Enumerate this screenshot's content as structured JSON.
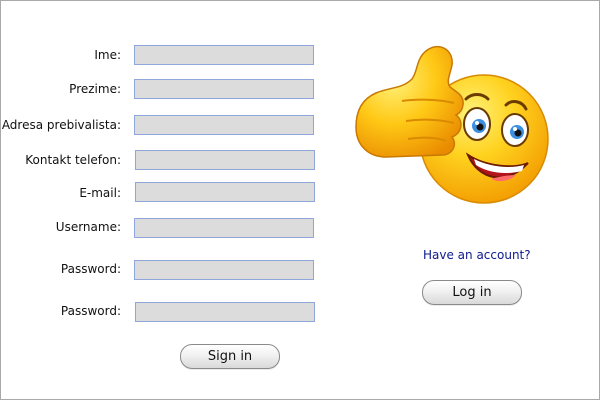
{
  "form": {
    "fields": [
      {
        "label": "Ime:",
        "value": "",
        "placeholder": ""
      },
      {
        "label": "Prezime:",
        "value": "",
        "placeholder": ""
      },
      {
        "label": "Adresa prebivalista:",
        "value": "",
        "placeholder": ""
      },
      {
        "label": "Kontakt telefon:",
        "value": "",
        "placeholder": ""
      },
      {
        "label": "E-mail:",
        "value": "",
        "placeholder": ""
      },
      {
        "label": "Username:",
        "value": "",
        "placeholder": ""
      },
      {
        "label": "Password:",
        "value": "",
        "placeholder": ""
      },
      {
        "label": "Password:",
        "value": "",
        "placeholder": ""
      }
    ],
    "sign_in_label": "Sign in"
  },
  "login": {
    "prompt": "Have an account?",
    "button_label": "Log in"
  },
  "image": {
    "icon": "thumbs-up-smiley-icon"
  },
  "colors": {
    "field_background": "#dcdcdc",
    "field_border": "#8ea6dc",
    "link": "#0d1a8c",
    "smiley_yellow": "#ffd21f",
    "smiley_orange": "#f5a100"
  }
}
